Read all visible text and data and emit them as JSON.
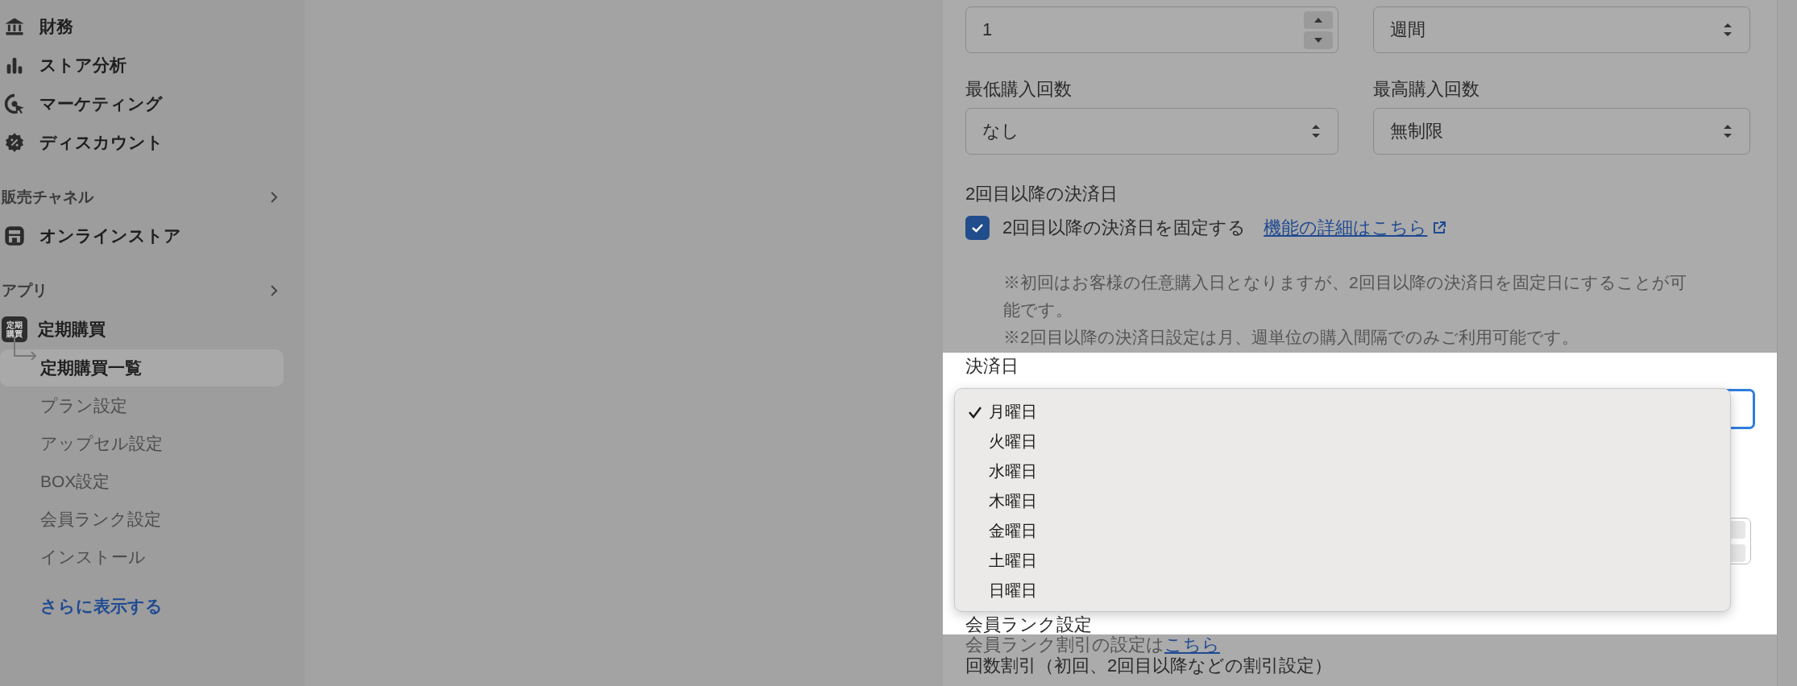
{
  "sidebar": {
    "items": [
      {
        "kind": "nav",
        "label": "財務"
      },
      {
        "kind": "nav",
        "label": "ストア分析"
      },
      {
        "kind": "nav",
        "label": "マーケティング"
      },
      {
        "kind": "nav",
        "label": "ディスカウント"
      },
      {
        "kind": "section",
        "label": "販売チャネル"
      },
      {
        "kind": "nav",
        "label": "オンラインストア"
      },
      {
        "kind": "section",
        "label": "アプリ"
      },
      {
        "kind": "app",
        "label": "定期購買",
        "badge": "定期購買"
      },
      {
        "kind": "sub",
        "label": "定期購買一覧",
        "selected": true
      },
      {
        "kind": "sub",
        "label": "プラン設定",
        "selected": false
      },
      {
        "kind": "sub",
        "label": "アップセル設定",
        "selected": false
      },
      {
        "kind": "sub",
        "label": "BOX設定",
        "selected": false
      },
      {
        "kind": "sub",
        "label": "会員ランク設定",
        "selected": false
      },
      {
        "kind": "sub",
        "label": "インストール",
        "selected": false
      },
      {
        "kind": "more",
        "label": "さらに表示する"
      }
    ]
  },
  "form": {
    "interval": {
      "value": "1",
      "unit": "週間"
    },
    "min_purchases": {
      "label": "最低購入回数",
      "value": "なし"
    },
    "max_purchases": {
      "label": "最高購入回数",
      "value": "無制限"
    },
    "payment_day": {
      "heading": "2回目以降の決済日",
      "checkbox": {
        "label": "2回目以降の決済日を固定する",
        "checked": true
      },
      "link": "機能の詳細はこちら",
      "notes": [
        "※初回はお客様の任意購入日となりますが、2回目以降の決済日を固定日にすることが可能です。",
        "※2回目以降の決済日設定は月、週単位の購入間隔でのみご利用可能です。"
      ]
    },
    "day_select": {
      "label": "決済日",
      "options": [
        {
          "label": "月曜日",
          "selected": true
        },
        {
          "label": "火曜日",
          "selected": false
        },
        {
          "label": "水曜日",
          "selected": false
        },
        {
          "label": "木曜日",
          "selected": false
        },
        {
          "label": "金曜日",
          "selected": false
        },
        {
          "label": "土曜日",
          "selected": false
        },
        {
          "label": "日曜日",
          "selected": false
        }
      ]
    },
    "member_rank": {
      "heading": "会員ランク設定",
      "text": "会員ランク割引の設定は",
      "link": "こちら"
    },
    "count_discount": {
      "heading": "回数割引（初回、2回目以降などの割引設定）"
    }
  }
}
